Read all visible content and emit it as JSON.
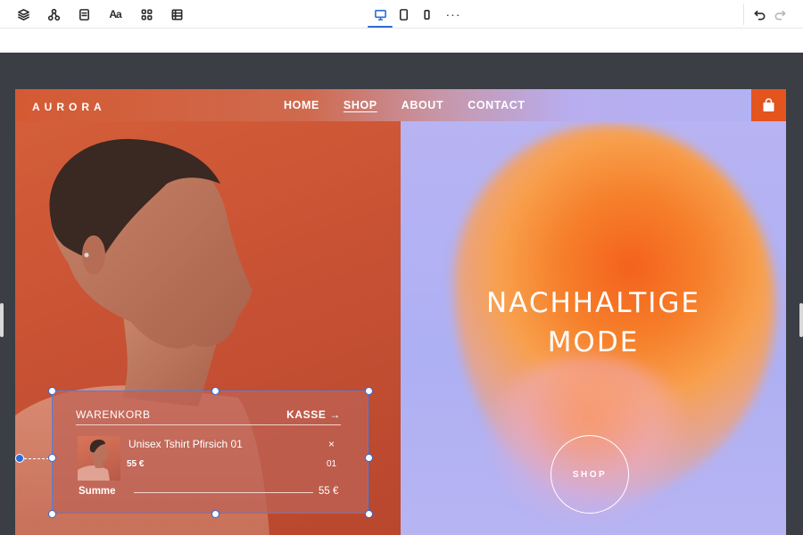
{
  "toolbar": {
    "left_icons": [
      "layers-icon",
      "components-icon",
      "pages-icon",
      "typography-icon",
      "apps-grid-icon",
      "table-icon"
    ],
    "typography_glyph": "Aa",
    "devices": [
      "desktop-icon",
      "tablet-icon",
      "mobile-icon"
    ],
    "active_device": "desktop",
    "more_label": "···",
    "history": [
      "undo-icon",
      "redo-icon"
    ]
  },
  "site": {
    "logo": "AURORA",
    "nav": [
      {
        "label": "HOME"
      },
      {
        "label": "SHOP",
        "current": true
      },
      {
        "label": "ABOUT"
      },
      {
        "label": "CONTACT"
      }
    ],
    "cart_icon": "shopping-bag-icon",
    "hero": {
      "line1": "NACHHALTIGE",
      "line2": "MODE"
    },
    "shop_button": "SHOP"
  },
  "cart": {
    "title": "WARENKORB",
    "checkout": "KASSE →",
    "item": {
      "name": "Unisex Tshirt Pfirsich 01",
      "price": "55 €",
      "qty": "01",
      "remove": "×"
    },
    "sum_label": "Summe",
    "sum_value": "55 €"
  },
  "colors": {
    "accent": "#2f6bd8",
    "brand_orange": "#e4541f",
    "workspace": "#3b3f45",
    "lavender": "#b3b2f4"
  }
}
